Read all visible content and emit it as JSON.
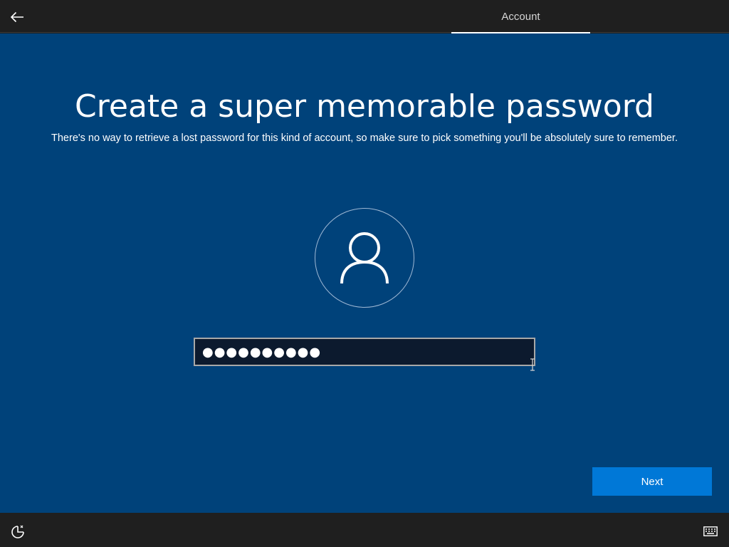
{
  "topbar": {
    "back_icon": "arrow-left-icon",
    "tab_label": "Account"
  },
  "main": {
    "title": "Create a super memorable password",
    "subtitle": "There's no way to retrieve a lost password for this kind of account, so make sure to pick something you'll be absolutely sure to remember.",
    "avatar_icon": "user-icon",
    "password_value": "●●●●●●●●●●",
    "next_label": "Next"
  },
  "bottombar": {
    "left_icon": "ease-of-access-icon",
    "right_icon": "keyboard-icon"
  },
  "colors": {
    "background": "#00427a",
    "bar": "#1f1f1f",
    "accent": "#0078d7",
    "field_bg": "#0c1a2e"
  }
}
